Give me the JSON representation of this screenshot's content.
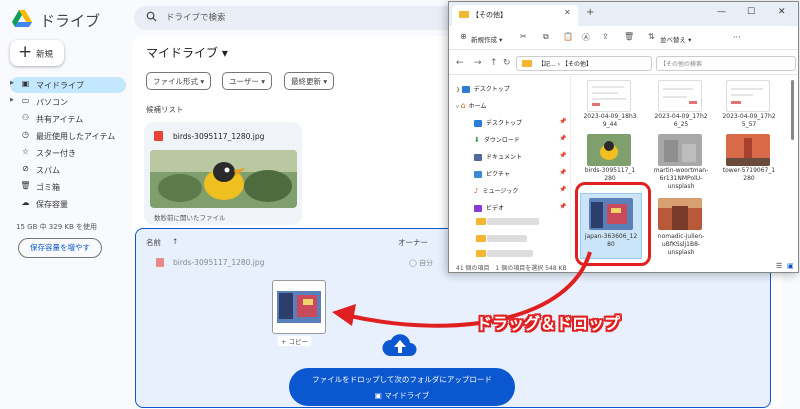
{
  "drive": {
    "app_name": "ドライブ",
    "search_placeholder": "ドライブで検索",
    "new_label": "新規",
    "nav": [
      {
        "label": "マイドライブ",
        "icon": "drive-icon"
      },
      {
        "label": "パソコン",
        "icon": "computer-icon"
      },
      {
        "label": "共有アイテム",
        "icon": "shared-icon"
      },
      {
        "label": "最近使用したアイテム",
        "icon": "clock-icon"
      },
      {
        "label": "スター付き",
        "icon": "star-icon"
      },
      {
        "label": "スパム",
        "icon": "spam-icon"
      },
      {
        "label": "ゴミ箱",
        "icon": "trash-icon"
      },
      {
        "label": "保存容量",
        "icon": "cloud-icon"
      }
    ],
    "storage_text": "15 GB 中 329 KB を使用",
    "storage_button": "保存容量を増やす",
    "page_title": "マイドライブ ▾",
    "filters": [
      "ファイル形式 ▾",
      "ユーザー ▾",
      "最終更新 ▾"
    ],
    "suggestions_label": "候補リスト",
    "card": {
      "title": "birds-3095117_1280.jpg",
      "note": "数秒前に開いたファイル"
    },
    "table": {
      "col_name": "名前",
      "col_owner": "オーナー"
    },
    "row": {
      "name": "birds-3095117_1280.jpg",
      "owner": "自分"
    },
    "copy_badge": "+ コピー",
    "drop_line1": "ファイルをドロップして次のフォルダにアップロード",
    "drop_line2": "マイドライブ"
  },
  "explorer": {
    "tab_title": "【その他】",
    "new_button": "新規作成 ▾",
    "sort_button": "並べ替え ▾",
    "more": "···",
    "address_left": "【記...",
    "address_right": "【その他】",
    "search_placeholder": "【その他の検索",
    "tree": [
      "デスクトップ",
      "ホーム",
      "デスクトップ",
      "ダウンロード",
      "ドキュメント",
      "ピクチャ",
      "ミュージック",
      "ビデオ"
    ],
    "files": [
      {
        "name": "2023-04-09_18h3 9_44"
      },
      {
        "name": "2023-04-09_17h2 6_25"
      },
      {
        "name": "2023-04-09_17h2 5_57"
      },
      {
        "name": "birds-3095117_1 280"
      },
      {
        "name": "martin-woortman-6r131NMPolU-unsplash"
      },
      {
        "name": "tower-5719067_1 280"
      },
      {
        "name": "japan-363606_12 80"
      },
      {
        "name": "nomadic-julien-uBfKSslj1B8-unsplash"
      }
    ],
    "status": "41 個の項目　1 個の項目を選択 548 KB"
  },
  "annotation": {
    "callout": "ドラッグ＆ドロップ"
  },
  "colors": {
    "accent": "#0b57d0",
    "annotation": "#e02020",
    "selected_nav": "#c2e7ff"
  }
}
